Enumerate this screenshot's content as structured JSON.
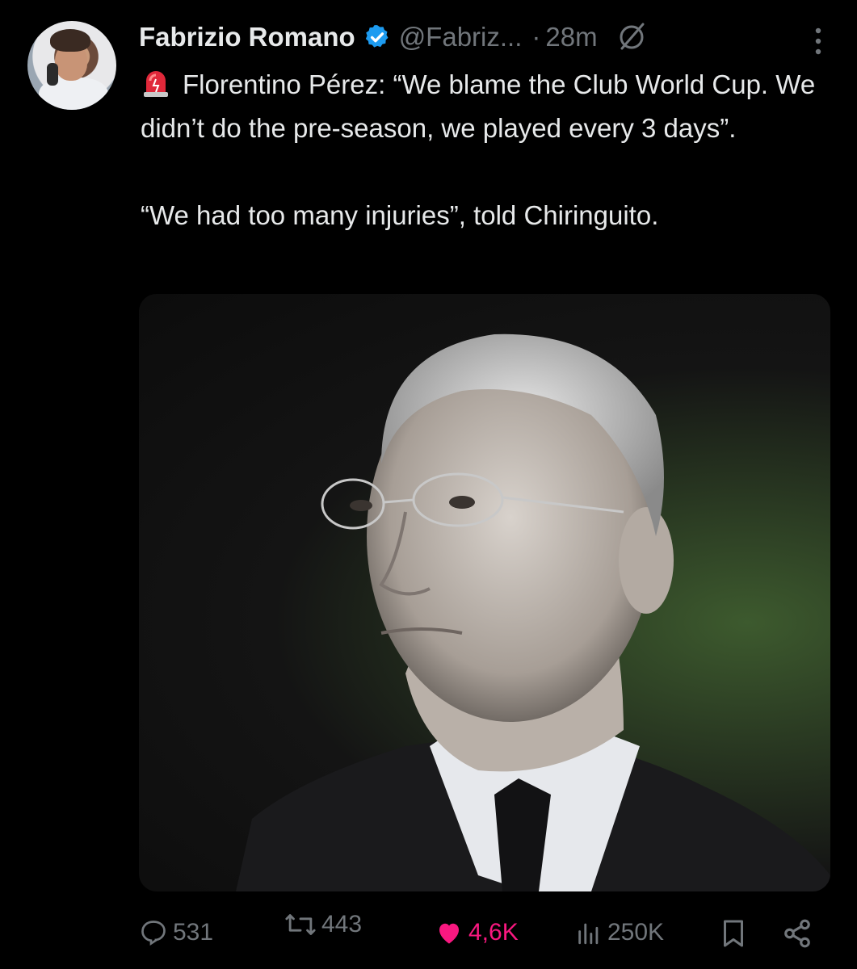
{
  "author": {
    "name": "Fabrizio Romano",
    "handle": "@Fabriz...",
    "time": "28m",
    "verified_color": "#1d9bf0",
    "avatar_icon": "profile-photo"
  },
  "tweet": {
    "siren_icon": "police-siren-emoji",
    "text": "Florentino Pérez: “We blame the Club World Cup. We didn’t do the pre-season, we played every 3 days”.\n\n“We had too many injuries”, told Chiringuito."
  },
  "media": {
    "kind": "photo"
  },
  "actions": {
    "replies": "531",
    "retweets": "443",
    "likes": "4,6K",
    "views": "250K",
    "like_color": "#f91880",
    "muted_color": "#71767b"
  }
}
